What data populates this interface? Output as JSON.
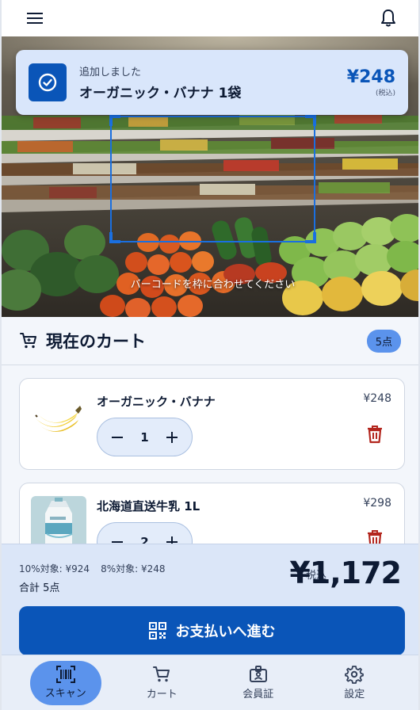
{
  "header": {
    "menu_icon": "menu-icon",
    "bell_icon": "bell-icon"
  },
  "toast": {
    "subtitle": "追加しました",
    "product": "オーガニック・バナナ 1袋",
    "price": "¥248",
    "tax_note": "(税込)"
  },
  "scanner": {
    "hint": "バーコードを枠に合わせてください"
  },
  "cart": {
    "title": "現在のカート",
    "badge": "5点",
    "items": [
      {
        "name": "オーガニック・バナナ",
        "price": "¥248",
        "qty": "1",
        "image": "banana"
      },
      {
        "name": "北海道直送牛乳 1L",
        "price": "¥298",
        "qty": "2",
        "image": "milk-carton"
      }
    ]
  },
  "summary": {
    "tax10": "10%対象: ¥924",
    "tax8": "8%対象: ¥248",
    "count": "合計 5点",
    "total_label": "税込",
    "total": "¥1,172",
    "pay_button": "お支払いへ進む"
  },
  "nav": {
    "items": [
      {
        "label": "スキャン",
        "icon": "barcode-scan-icon",
        "active": true
      },
      {
        "label": "カート",
        "icon": "cart-icon",
        "active": false
      },
      {
        "label": "会員証",
        "icon": "member-card-icon",
        "active": false
      },
      {
        "label": "設定",
        "icon": "gear-icon",
        "active": false
      }
    ]
  },
  "colors": {
    "primary": "#0a55b8",
    "accent": "#5b93ec",
    "danger": "#b3261e"
  }
}
